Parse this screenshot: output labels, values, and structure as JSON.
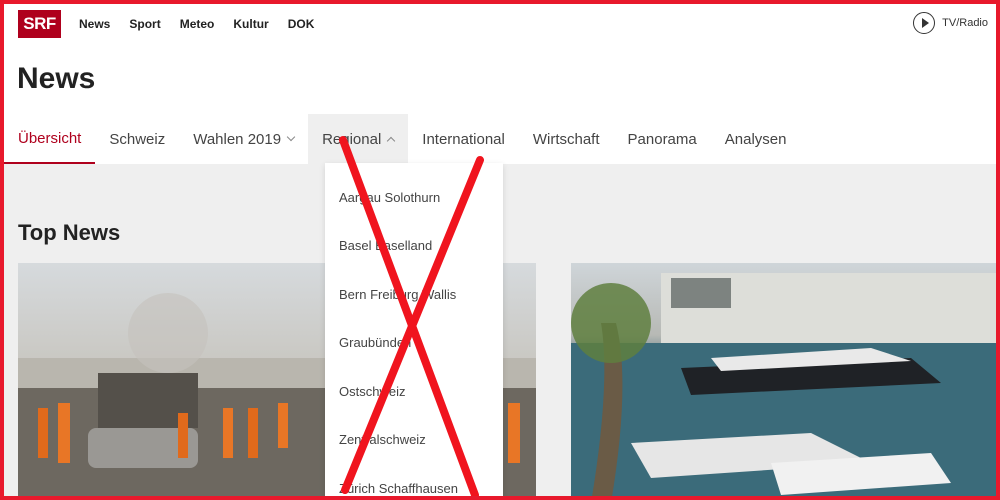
{
  "brand": {
    "logo_text": "SRF"
  },
  "topnav": {
    "items": [
      "News",
      "Sport",
      "Meteo",
      "Kultur",
      "DOK"
    ]
  },
  "tvradio": {
    "label": "TV/Radio",
    "icon": "play-icon"
  },
  "page": {
    "title": "News"
  },
  "nav": {
    "tabs": [
      {
        "label": "Übersicht",
        "active": true
      },
      {
        "label": "Schweiz"
      },
      {
        "label": "Wahlen 2019",
        "has_dropdown": true
      },
      {
        "label": "Regional",
        "has_dropdown": true,
        "open": true
      },
      {
        "label": "International"
      },
      {
        "label": "Wirtschaft"
      },
      {
        "label": "Panorama"
      },
      {
        "label": "Analysen"
      }
    ]
  },
  "dropdown": {
    "items": [
      "Aargau Solothurn",
      "Basel Baselland",
      "Bern Freiburg Wallis",
      "Graubünden",
      "Ostschweiz",
      "Zentralschweiz",
      "Zürich Schaffhausen"
    ]
  },
  "section": {
    "title": "Top News"
  },
  "colors": {
    "accent": "#af001d",
    "frame": "#e8192c",
    "cross": "#f0141e"
  }
}
